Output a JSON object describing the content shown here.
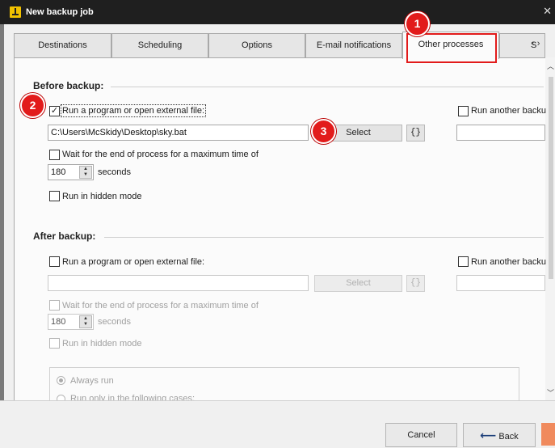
{
  "window": {
    "title": "New backup job"
  },
  "tabs": [
    {
      "label": "Destinations"
    },
    {
      "label": "Scheduling"
    },
    {
      "label": "Options"
    },
    {
      "label": "E-mail notifications"
    },
    {
      "label": "Other processes"
    },
    {
      "label": "S"
    }
  ],
  "before": {
    "heading": "Before backup:",
    "run_program_label": "Run a program or open external file:",
    "run_program_checked": true,
    "path_value": "C:\\Users\\McSkidy\\Desktop\\sky.bat",
    "select_label": "Select",
    "brace_label": "{}",
    "run_another_label": "Run another backu",
    "wait_label": "Wait for the end of process for a maximum time of",
    "timeout_value": "180",
    "seconds_label": "seconds",
    "hidden_label": "Run in hidden mode"
  },
  "after": {
    "heading": "After backup:",
    "run_program_label": "Run a program or open external file:",
    "path_value": "",
    "select_label": "Select",
    "brace_label": "{}",
    "run_another_label": "Run another backu",
    "wait_label": "Wait for the end of process for a maximum time of",
    "timeout_value": "180",
    "seconds_label": "seconds",
    "hidden_label": "Run in hidden mode",
    "always_run_label": "Always run",
    "only_cases_label": "Run only in the following cases:"
  },
  "footer": {
    "cancel_label": "Cancel",
    "back_label": "Back"
  },
  "annotations": [
    "1",
    "2",
    "3"
  ],
  "colors": {
    "marker": "#e21b1b",
    "titlebar": "#1f1f1f",
    "accent_orange": "#f08a5d"
  }
}
